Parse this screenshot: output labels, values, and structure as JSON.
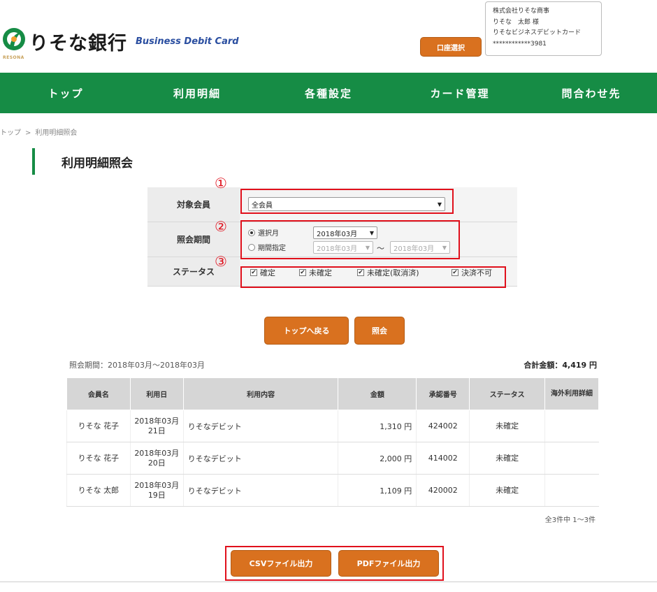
{
  "header": {
    "bank_name": "りそな銀行",
    "bank_sub": "RESONA",
    "card_name": "Business Debit Card",
    "account_button": "口座選択",
    "user_company": "株式会社りそな商事",
    "user_name": "りそな　太郎 様",
    "user_card": "りそなビジネスデビットカード",
    "user_card_number": "************3981"
  },
  "nav": [
    "トップ",
    "利用明細",
    "各種設定",
    "カード管理",
    "問合わせ先"
  ],
  "breadcrumb": {
    "home": "トップ",
    "sep": ">",
    "current": "利用明細照会"
  },
  "page_title": "利用明細照会",
  "form": {
    "member_label": "対象会員",
    "member_value": "全会員",
    "period_label": "照会期間",
    "radio_month": "選択月",
    "radio_month_value": "2018年03月",
    "radio_range": "期間指定",
    "range_from": "2018年03月",
    "range_tilde": "～",
    "range_to": "2018年03月",
    "status_label": "ステータス",
    "statuses": [
      "確定",
      "未確定",
      "未確定(取消済)",
      "決済不可"
    ],
    "markers": [
      "①",
      "②",
      "③"
    ],
    "caret": "▼",
    "check": "✔"
  },
  "buttons": {
    "back_top": "トップへ戻る",
    "search": "照会",
    "csv": "CSVファイル出力",
    "pdf": "PDFファイル出力"
  },
  "summary": {
    "period": "照会期間：2018年03月～2018年03月",
    "total": "合計金額：4,419 円"
  },
  "table": {
    "headers": [
      "会員名",
      "利用日",
      "利用内容",
      "金額",
      "承認番号",
      "ステータス",
      "海外利用詳細"
    ],
    "rows": [
      {
        "member": "りそな 花子",
        "date": "2018年03月21日",
        "content": "りそなデビット",
        "amount": "1,310 円",
        "approval": "424002",
        "status": "未確定",
        "detail": ""
      },
      {
        "member": "りそな 花子",
        "date": "2018年03月20日",
        "content": "りそなデビット",
        "amount": "2,000 円",
        "approval": "414002",
        "status": "未確定",
        "detail": ""
      },
      {
        "member": "りそな 太郎",
        "date": "2018年03月19日",
        "content": "りそなデビット",
        "amount": "1,109 円",
        "approval": "420002",
        "status": "未確定",
        "detail": ""
      }
    ]
  },
  "pagination": "全3件中 1～3件",
  "colors": {
    "brand_green": "#168c45",
    "accent_orange": "#d9711f",
    "highlight_red": "#e0101c"
  }
}
